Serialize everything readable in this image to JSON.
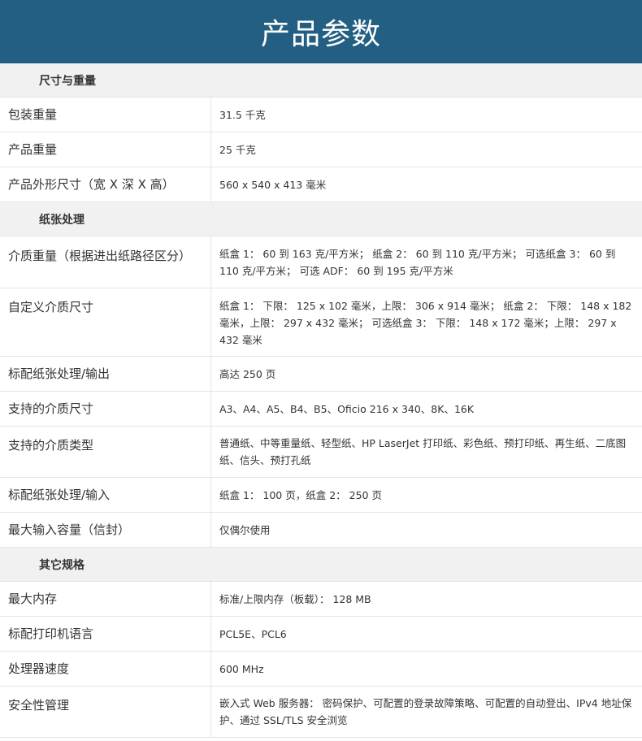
{
  "page_title": "产品参数",
  "sections": [
    {
      "title": "尺寸与重量",
      "rows": [
        {
          "label": "包装重量",
          "value": "31.5 千克"
        },
        {
          "label": "产品重量",
          "value": "25 千克"
        },
        {
          "label": "产品外形尺寸（宽 X 深 X 高）",
          "value": "560 x 540 x 413 毫米"
        }
      ]
    },
    {
      "title": "纸张处理",
      "rows": [
        {
          "label": "介质重量（根据进出纸路径区分）",
          "value": "纸盒 1： 60 到 163 克/平方米； 纸盒 2： 60 到 110 克/平方米； 可选纸盒 3： 60 到 110 克/平方米； 可选 ADF： 60 到 195 克/平方米"
        },
        {
          "label": "自定义介质尺寸",
          "value": "纸盒 1： 下限： 125 x 102 毫米，上限： 306 x 914 毫米； 纸盒 2： 下限： 148 x 182 毫米，上限： 297 x 432 毫米； 可选纸盒 3： 下限： 148 x 172 毫米；上限： 297 x 432 毫米"
        },
        {
          "label": "标配纸张处理/输出",
          "value": "高达 250 页"
        },
        {
          "label": "支持的介质尺寸",
          "value": "A3、A4、A5、B4、B5、Oficio 216 x 340、8K、16K"
        },
        {
          "label": "支持的介质类型",
          "value": "普通纸、中等重量纸、轻型纸、HP LaserJet 打印纸、彩色纸、预打印纸、再生纸、二底图纸、信头、预打孔纸"
        },
        {
          "label": "标配纸张处理/输入",
          "value": "纸盒 1： 100 页，纸盒 2： 250 页"
        },
        {
          "label": "最大输入容量（信封）",
          "value": "仅偶尔使用"
        }
      ]
    },
    {
      "title": "其它规格",
      "rows": [
        {
          "label": "最大内存",
          "value": "标准/上限内存（板载）： 128 MB"
        },
        {
          "label": "标配打印机语言",
          "value": "PCL5E、PCL6"
        },
        {
          "label": "处理器速度",
          "value": "600 MHz"
        },
        {
          "label": "安全性管理",
          "value": "嵌入式 Web 服务器： 密码保护、可配置的登录故障策略、可配置的自动登出、IPv4 地址保护、通过 SSL/TLS 安全浏览"
        }
      ]
    }
  ]
}
